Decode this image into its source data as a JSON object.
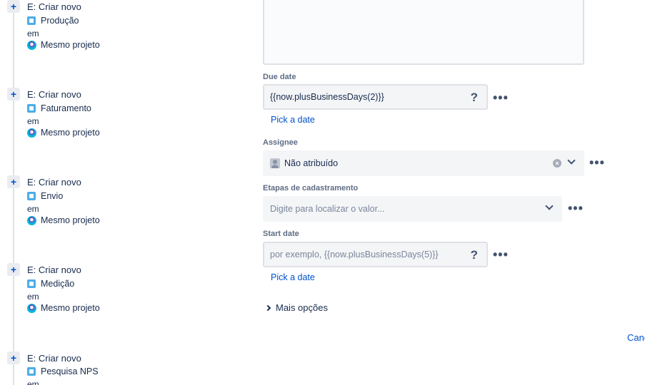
{
  "rules": [
    {
      "title": "E: Criar novo",
      "issue": "Produção",
      "em": "em",
      "project": "Mesmo projeto"
    },
    {
      "title": "E: Criar novo",
      "issue": "Faturamento",
      "em": "em",
      "project": "Mesmo projeto"
    },
    {
      "title": "E: Criar novo",
      "issue": "Envio",
      "em": "em",
      "project": "Mesmo projeto"
    },
    {
      "title": "E: Criar novo",
      "issue": "Medição",
      "em": "em",
      "project": "Mesmo projeto"
    },
    {
      "title": "E: Criar novo",
      "issue": "Pesquisa NPS",
      "em": "em",
      "project": ""
    }
  ],
  "form": {
    "due_date": {
      "label": "Due date",
      "value": "{{now.plusBusinessDays(2)}}",
      "help": "?",
      "pick": "Pick a date"
    },
    "assignee": {
      "label": "Assignee",
      "value": "Não atribuído"
    },
    "etapas": {
      "label": "Etapas de cadastramento",
      "placeholder": "Digite para localizar o valor..."
    },
    "start_date": {
      "label": "Start date",
      "placeholder": "por exemplo, {{now.plusBusinessDays(5)}}",
      "help": "?",
      "pick": "Pick a date"
    },
    "more_options": "Mais opções",
    "more_menu": "•••"
  },
  "footer": {
    "cancel": "Canc"
  },
  "icons": {
    "plus": "+",
    "clear": "×"
  }
}
